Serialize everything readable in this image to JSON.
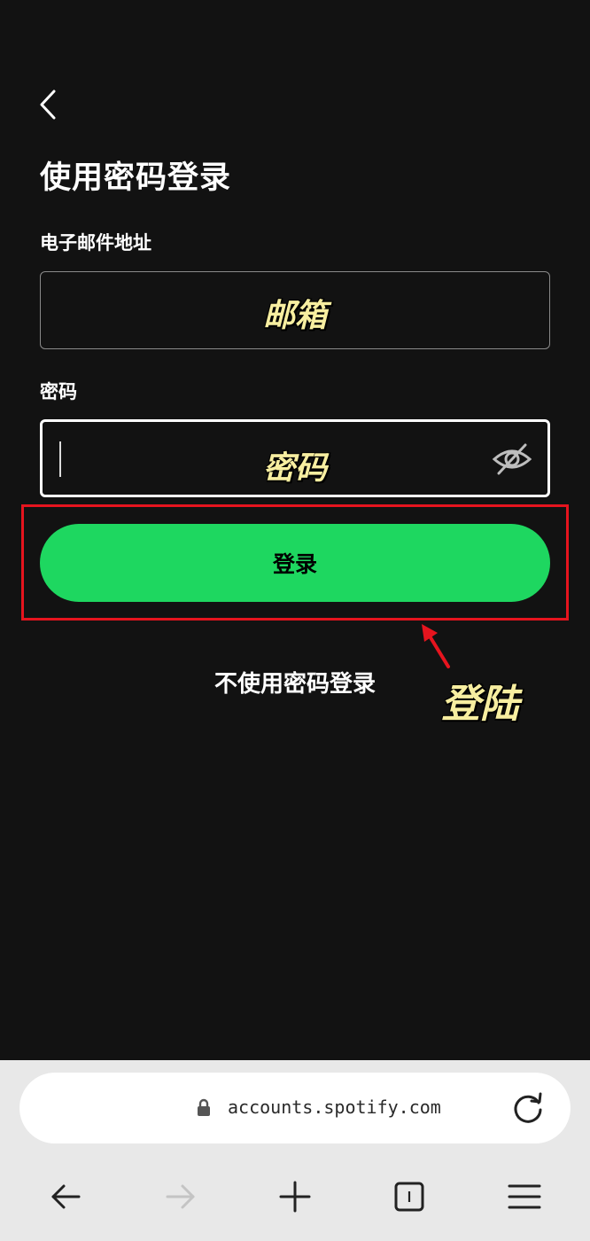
{
  "page": {
    "title": "使用密码登录",
    "back_icon": "chevron-left-icon"
  },
  "form": {
    "email_label": "电子邮件地址",
    "email_overlay": "邮箱",
    "password_label": "密码",
    "password_overlay": "密码",
    "password_toggle_icon": "eye-off-icon",
    "login_button": "登录",
    "passwordless_link": "不使用密码登录"
  },
  "annotation": {
    "label": "登陆",
    "color": "#e6141e",
    "label_color": "#f7eea0"
  },
  "browser": {
    "url": "accounts.spotify.com",
    "lock_icon": "lock-icon",
    "reload_icon": "reload-icon",
    "nav": [
      "back-arrow-icon",
      "forward-arrow-icon",
      "new-tab-plus-icon",
      "tabs-icon",
      "menu-icon"
    ],
    "tab_count": "1"
  },
  "colors": {
    "background": "#121212",
    "accent": "#1ed760",
    "browser_bar": "#e8e8e8"
  }
}
